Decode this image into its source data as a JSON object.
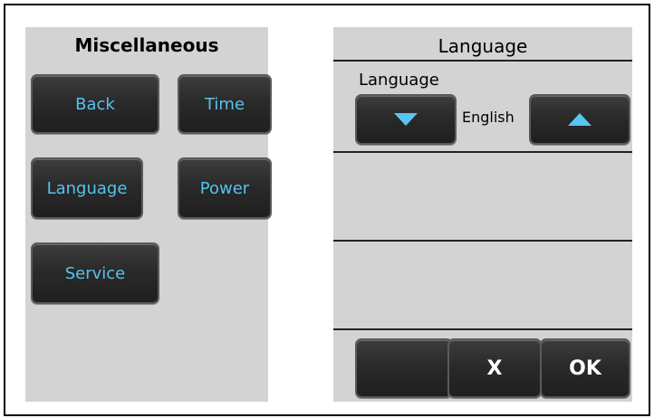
{
  "misc": {
    "title": "Miscellaneous",
    "buttons": {
      "back": "Back",
      "time": "Time",
      "language": "Language",
      "power": "Power",
      "service": "Service"
    }
  },
  "language_screen": {
    "title": "Language",
    "section_label": "Language",
    "current_value": "English",
    "down_icon": "triangle-down-icon",
    "up_icon": "triangle-up-icon",
    "cancel_label": "X",
    "ok_label": "OK"
  },
  "colors": {
    "panel_background": "#d3d3d3",
    "button_background": "#2a2a2a",
    "button_text": "#55c3ee",
    "icon_accent": "#58c6f2"
  }
}
